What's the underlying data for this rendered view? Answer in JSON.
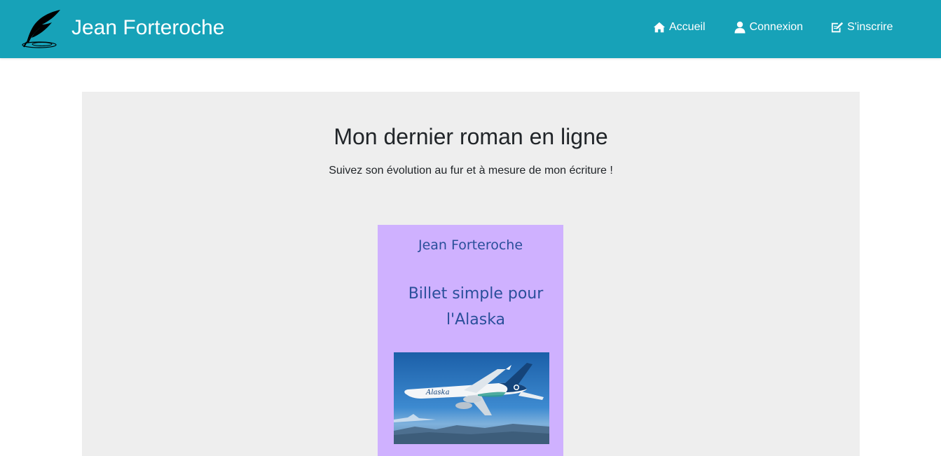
{
  "header": {
    "brand": "Jean Forteroche",
    "logo_icon": "feather-quill-icon",
    "background": "#17a2b8",
    "nav": [
      {
        "label": "Accueil",
        "icon": "home-icon"
      },
      {
        "label": "Connexion",
        "icon": "user-icon"
      },
      {
        "label": "S'inscrire",
        "icon": "signup-edit-icon"
      }
    ]
  },
  "hero": {
    "title": "Mon dernier roman en ligne",
    "subtitle": "Suivez son évolution au fur et à mesure de mon écriture !",
    "background": "#eeeeee"
  },
  "book": {
    "author": "Jean Forteroche",
    "title": "Billet simple pour l'Alaska",
    "cover_color": "#cfb1ff",
    "text_color": "#2a4f9a",
    "image": {
      "subject": "airplane-photo",
      "livery_text": "Alaska"
    }
  }
}
